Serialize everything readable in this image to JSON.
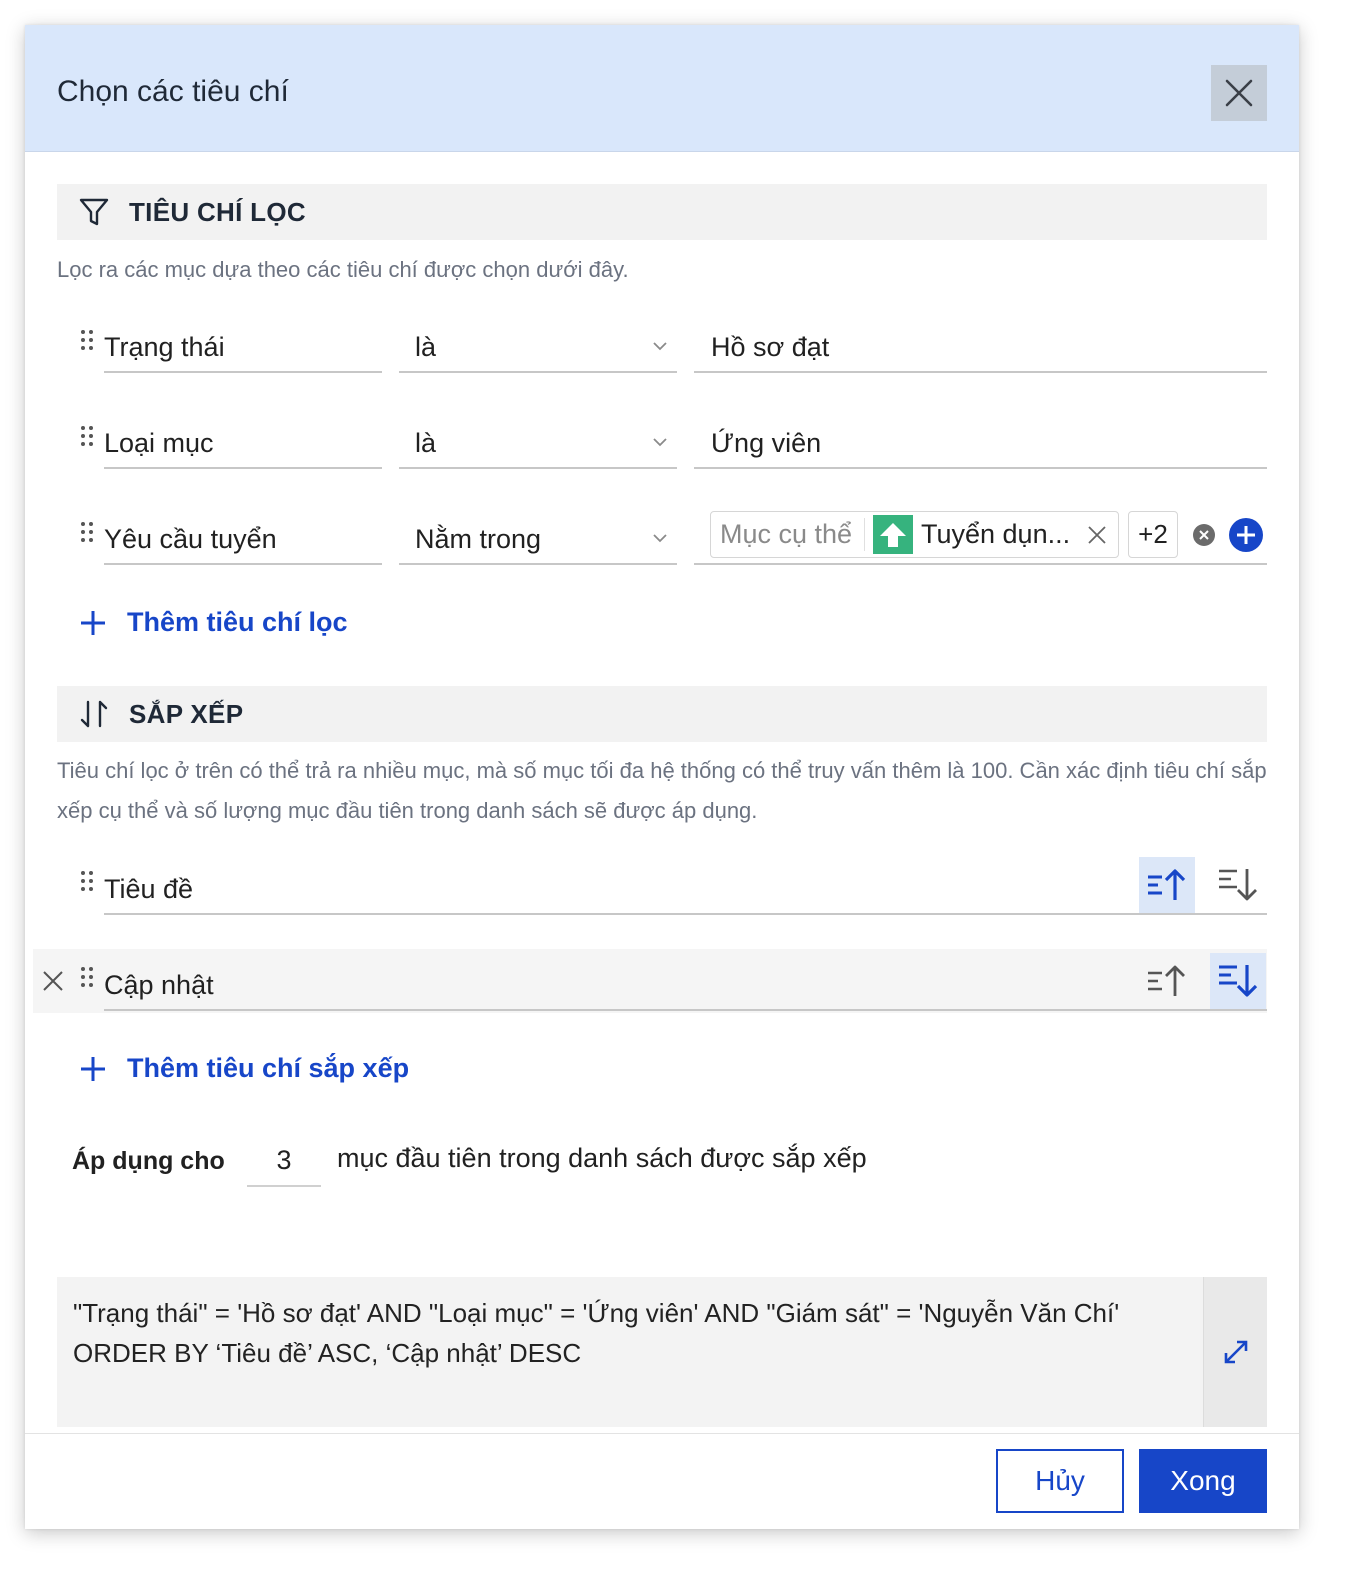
{
  "dialog": {
    "title": "Chọn các tiêu chí",
    "close_icon": "close-icon"
  },
  "filter_section": {
    "title": "TIÊU CHÍ LỌC",
    "icon": "funnel-icon",
    "description": "Lọc ra các mục dựa theo các tiêu chí được chọn dưới đây.",
    "rows": [
      {
        "field": "Trạng thái",
        "operator": "là",
        "value": "Hồ sơ đạt"
      },
      {
        "field": "Loại mục",
        "operator": "là",
        "value": "Ứng viên"
      },
      {
        "field": "Yêu cầu tuyển",
        "operator": "Nằm trong",
        "value_placeholder": "Mục cụ thể",
        "tag_label": "Tuyển dụn...",
        "more_count": "+2"
      }
    ],
    "add_label": "Thêm tiêu chí lọc"
  },
  "sort_section": {
    "title": "SẮP XẾP",
    "icon": "sort-arrows-icon",
    "description": "Tiêu chí lọc ở trên có thể trả ra nhiều mục, mà số mục tối đa hệ thống có thể truy vấn thêm là 100. Cần xác định tiêu chí sắp xếp cụ thể và số lượng mục đầu tiên trong danh sách sẽ được áp dụng.",
    "rows": [
      {
        "field": "Tiêu đề",
        "direction": "asc"
      },
      {
        "field": "Cập nhật",
        "direction": "desc"
      }
    ],
    "add_label": "Thêm tiêu chí sắp xếp"
  },
  "apply": {
    "label": "Áp dụng cho",
    "count": "3",
    "suffix": "mục đầu tiên trong danh sách được sắp xếp"
  },
  "query": {
    "text": "\"Trạng thái\" = 'Hồ sơ đạt' AND \"Loại mục\" = 'Ứng viên' AND \"Giám sát\" = 'Nguyễn Văn Chí' ORDER BY ‘Tiêu đề’ ASC, ‘Cập nhật’ DESC"
  },
  "footer": {
    "cancel_label": "Hủy",
    "done_label": "Xong"
  },
  "colors": {
    "accent": "#1746c8",
    "header_bg": "#d9e7fb",
    "tag_green": "#36b37e"
  }
}
